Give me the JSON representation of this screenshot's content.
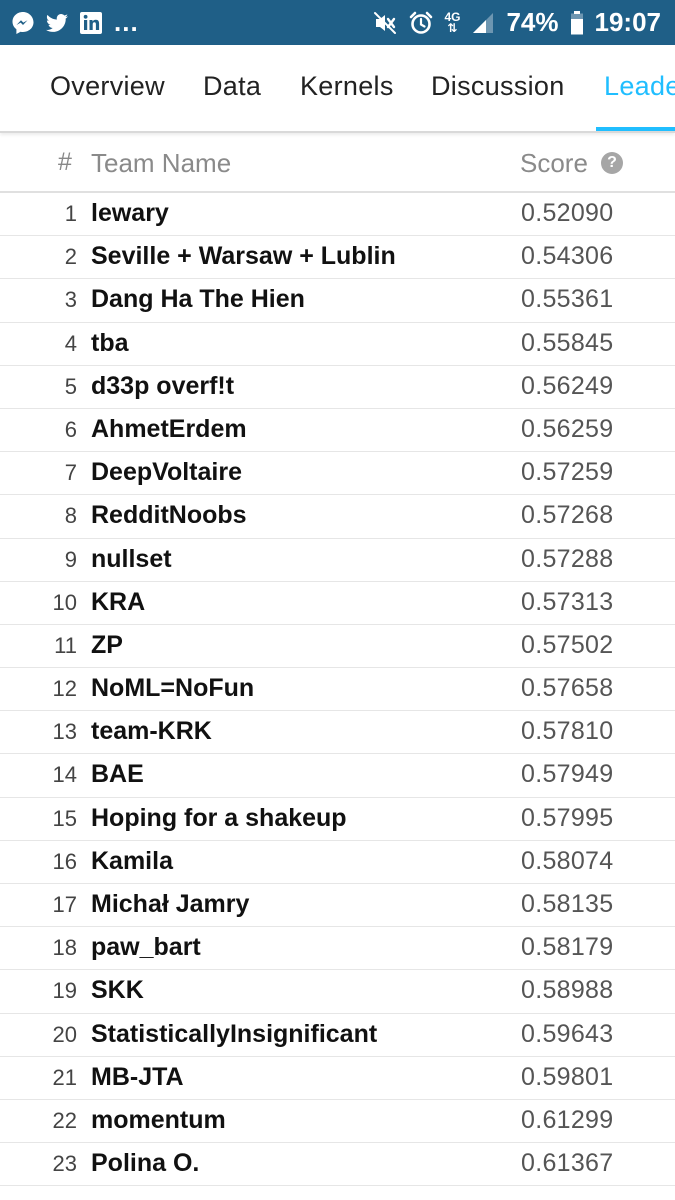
{
  "statusbar": {
    "left_icons": [
      "messenger-icon",
      "twitter-icon",
      "linkedin-icon"
    ],
    "more": "...",
    "network_top": "4G",
    "battery_text": "74%",
    "time": "19:07",
    "bg_color": "#1f5f87"
  },
  "tabs": [
    {
      "label": "Overview",
      "active": false
    },
    {
      "label": "Data",
      "active": false
    },
    {
      "label": "Kernels",
      "active": false
    },
    {
      "label": "Discussion",
      "active": false
    },
    {
      "label": "Leade",
      "active": true
    }
  ],
  "accent_color": "#20beff",
  "table": {
    "headers": {
      "rank": "#",
      "team": "Team Name",
      "score": "Score",
      "help": "?"
    },
    "rows": [
      {
        "rank": "1",
        "team": "lewary",
        "score": "0.52090"
      },
      {
        "rank": "2",
        "team": "Seville + Warsaw + Lublin",
        "score": "0.54306"
      },
      {
        "rank": "3",
        "team": "Dang Ha The Hien",
        "score": "0.55361"
      },
      {
        "rank": "4",
        "team": "tba",
        "score": "0.55845"
      },
      {
        "rank": "5",
        "team": "d33p overf!t",
        "score": "0.56249"
      },
      {
        "rank": "6",
        "team": "AhmetErdem",
        "score": "0.56259"
      },
      {
        "rank": "7",
        "team": "DeepVoltaire",
        "score": "0.57259"
      },
      {
        "rank": "8",
        "team": "RedditNoobs",
        "score": "0.57268"
      },
      {
        "rank": "9",
        "team": "nullset",
        "score": "0.57288"
      },
      {
        "rank": "10",
        "team": "KRA",
        "score": "0.57313"
      },
      {
        "rank": "11",
        "team": "ZP",
        "score": "0.57502"
      },
      {
        "rank": "12",
        "team": "NoML=NoFun",
        "score": "0.57658"
      },
      {
        "rank": "13",
        "team": "team-KRK",
        "score": "0.57810"
      },
      {
        "rank": "14",
        "team": "BAE",
        "score": "0.57949"
      },
      {
        "rank": "15",
        "team": "Hoping for a shakeup",
        "score": "0.57995"
      },
      {
        "rank": "16",
        "team": "Kamila",
        "score": "0.58074"
      },
      {
        "rank": "17",
        "team": "Michał Jamry",
        "score": "0.58135"
      },
      {
        "rank": "18",
        "team": "paw_bart",
        "score": "0.58179"
      },
      {
        "rank": "19",
        "team": "SKK",
        "score": "0.58988"
      },
      {
        "rank": "20",
        "team": "StatisticallyInsignificant",
        "score": "0.59643"
      },
      {
        "rank": "21",
        "team": "MB-JTA",
        "score": "0.59801"
      },
      {
        "rank": "22",
        "team": "momentum",
        "score": "0.61299"
      },
      {
        "rank": "23",
        "team": "Polina O.",
        "score": "0.61367"
      }
    ]
  }
}
